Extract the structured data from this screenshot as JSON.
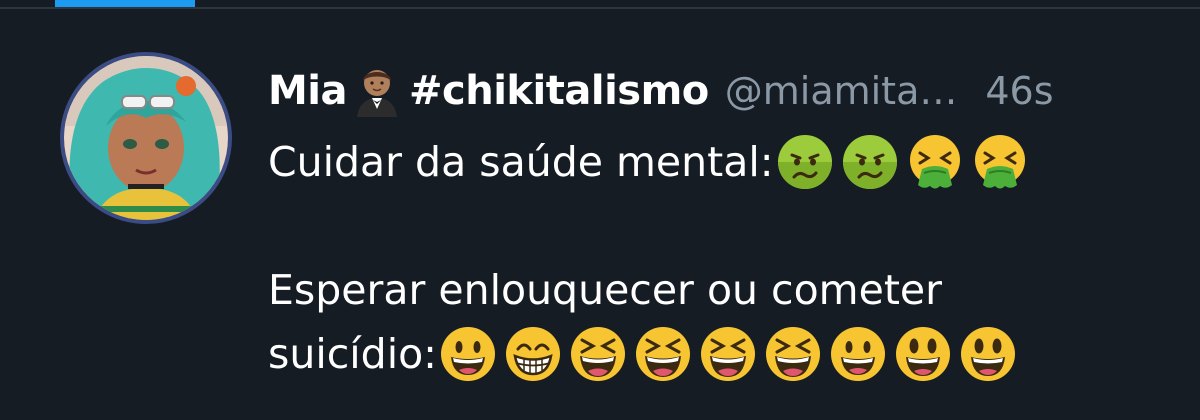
{
  "tweet": {
    "display_name": "Mia",
    "name_emoji": "man-in-tuxedo-emoji",
    "hashtag": "#chikitalismo",
    "handle": "@miamita…",
    "timestamp": "46s",
    "body": {
      "line1_text": "Cuidar da saúde mental:",
      "line1_emojis": [
        "nauseated-face",
        "nauseated-face",
        "face-vomiting",
        "face-vomiting"
      ],
      "line2_text": "Esperar enlouquecer ou cometer",
      "line3_text": "suicídio:",
      "line3_emojis": [
        "grinning-face",
        "beaming-face",
        "grinning-squinting-face",
        "grinning-squinting-face",
        "grinning-squinting-face",
        "grinning-squinting-face",
        "grinning-face",
        "grinning-face-big-eyes",
        "grinning-face-big-eyes"
      ]
    }
  },
  "colors": {
    "background": "#151c24",
    "primary_text": "#ffffff",
    "secondary_text": "#8b98a5",
    "accent": "#1d9bf0"
  }
}
